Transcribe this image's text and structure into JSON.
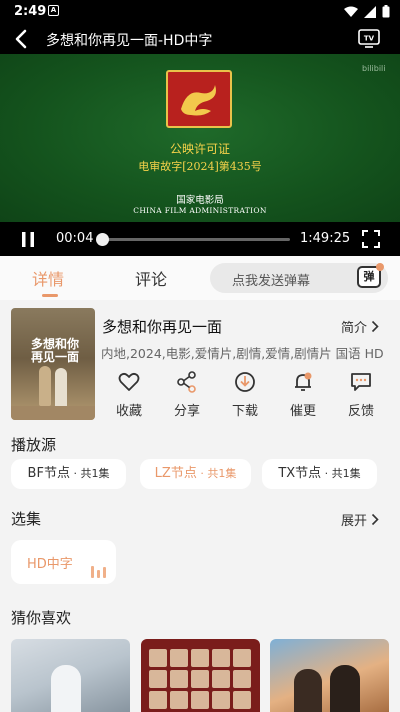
{
  "status_bar": {
    "time": "2:49",
    "notification_icon": "A"
  },
  "player": {
    "title": "多想和你再见一面-HD中字",
    "tv_label": "TV",
    "video_watermark": "bilibili",
    "license_title": "公映许可证",
    "license_number": "电审故字[2024]第435号",
    "bureau_cn": "国家电影局",
    "bureau_en": "CHINA FILM ADMINISTRATION",
    "current_time": "00:04",
    "duration": "1:49:25",
    "progress_fraction": 0.0006
  },
  "tabs": {
    "detail": "详情",
    "comment": "评论",
    "danmaku_placeholder": "点我发送弹幕",
    "danmaku_button": "弹"
  },
  "movie": {
    "title": "多想和你再见一面",
    "intro_label": "简介",
    "tags": "内地,2024,电影,爱情片,剧情,爱情,剧情片 国语 HD",
    "poster_title": "多想和你再见一面"
  },
  "actions": [
    {
      "label": "收藏",
      "icon": "heart-icon"
    },
    {
      "label": "分享",
      "icon": "share-icon"
    },
    {
      "label": "下载",
      "icon": "download-icon"
    },
    {
      "label": "催更",
      "icon": "bell-icon"
    },
    {
      "label": "反馈",
      "icon": "feedback-icon"
    }
  ],
  "sources": {
    "title": "播放源",
    "items": [
      {
        "name": "BF节点",
        "count": " · 共1集",
        "active": false
      },
      {
        "name": "LZ节点",
        "count": " · 共1集",
        "active": true
      },
      {
        "name": "TX节点",
        "count": " · 共1集",
        "active": false
      }
    ]
  },
  "episodes": {
    "title": "选集",
    "expand_label": "展开",
    "items": [
      {
        "label": "HD中字",
        "playing": true
      }
    ]
  },
  "recommend": {
    "title": "猜你喜欢"
  },
  "colors": {
    "accent": "#e9986a",
    "video_bg": "#14531d",
    "license_gold": "#f6d24a"
  }
}
